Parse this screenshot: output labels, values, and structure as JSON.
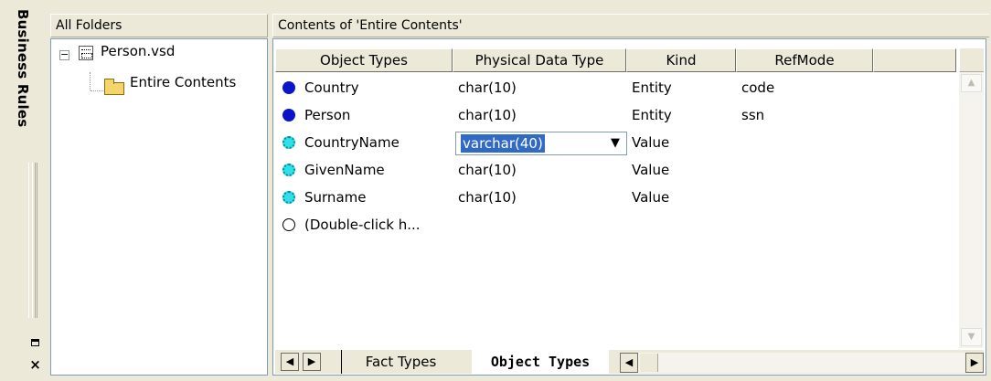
{
  "sidebar": {
    "title": "Business Rules",
    "pin_icon": "pin-icon",
    "close_icon": "close-icon",
    "close_glyph": "×"
  },
  "folders": {
    "header": "All Folders",
    "expander_glyph": "−",
    "root": {
      "label": "Person.vsd",
      "icon": "document-icon"
    },
    "child": {
      "label": "Entire Contents",
      "icon": "folder-icon"
    }
  },
  "contents": {
    "header": "Contents of 'Entire Contents'",
    "columns": [
      "Object Types",
      "Physical Data Type",
      "Kind",
      "RefMode",
      ""
    ],
    "rows": [
      {
        "name": "Country",
        "type": "char(10)",
        "kind": "Entity",
        "refmode": "code",
        "marker": "entity"
      },
      {
        "name": "Person",
        "type": "char(10)",
        "kind": "Entity",
        "refmode": "ssn",
        "marker": "entity"
      },
      {
        "name": "CountryName",
        "type": "varchar(40)",
        "kind": "Value",
        "refmode": "",
        "marker": "value",
        "editing": true
      },
      {
        "name": "GivenName",
        "type": "char(10)",
        "kind": "Value",
        "refmode": "",
        "marker": "value"
      },
      {
        "name": "Surname",
        "type": "char(10)",
        "kind": "Value",
        "refmode": "",
        "marker": "value"
      },
      {
        "name": "(Double-click h...",
        "type": "",
        "kind": "",
        "refmode": "",
        "marker": "new"
      }
    ],
    "combo_dropdown_glyph": "▼"
  },
  "tabs": {
    "items": [
      "Fact Types",
      "Object Types"
    ],
    "active": "Object Types",
    "nav_first": "◀",
    "nav_next": "▶"
  },
  "scroll": {
    "up_glyph": "▲",
    "down_glyph": "▼",
    "left_glyph": "◀",
    "right_glyph": "▶"
  },
  "colors": {
    "entity_marker": "#0a14c8",
    "value_marker": "#2ee0e8",
    "selection": "#316ac5",
    "chrome": "#ece9d8"
  }
}
